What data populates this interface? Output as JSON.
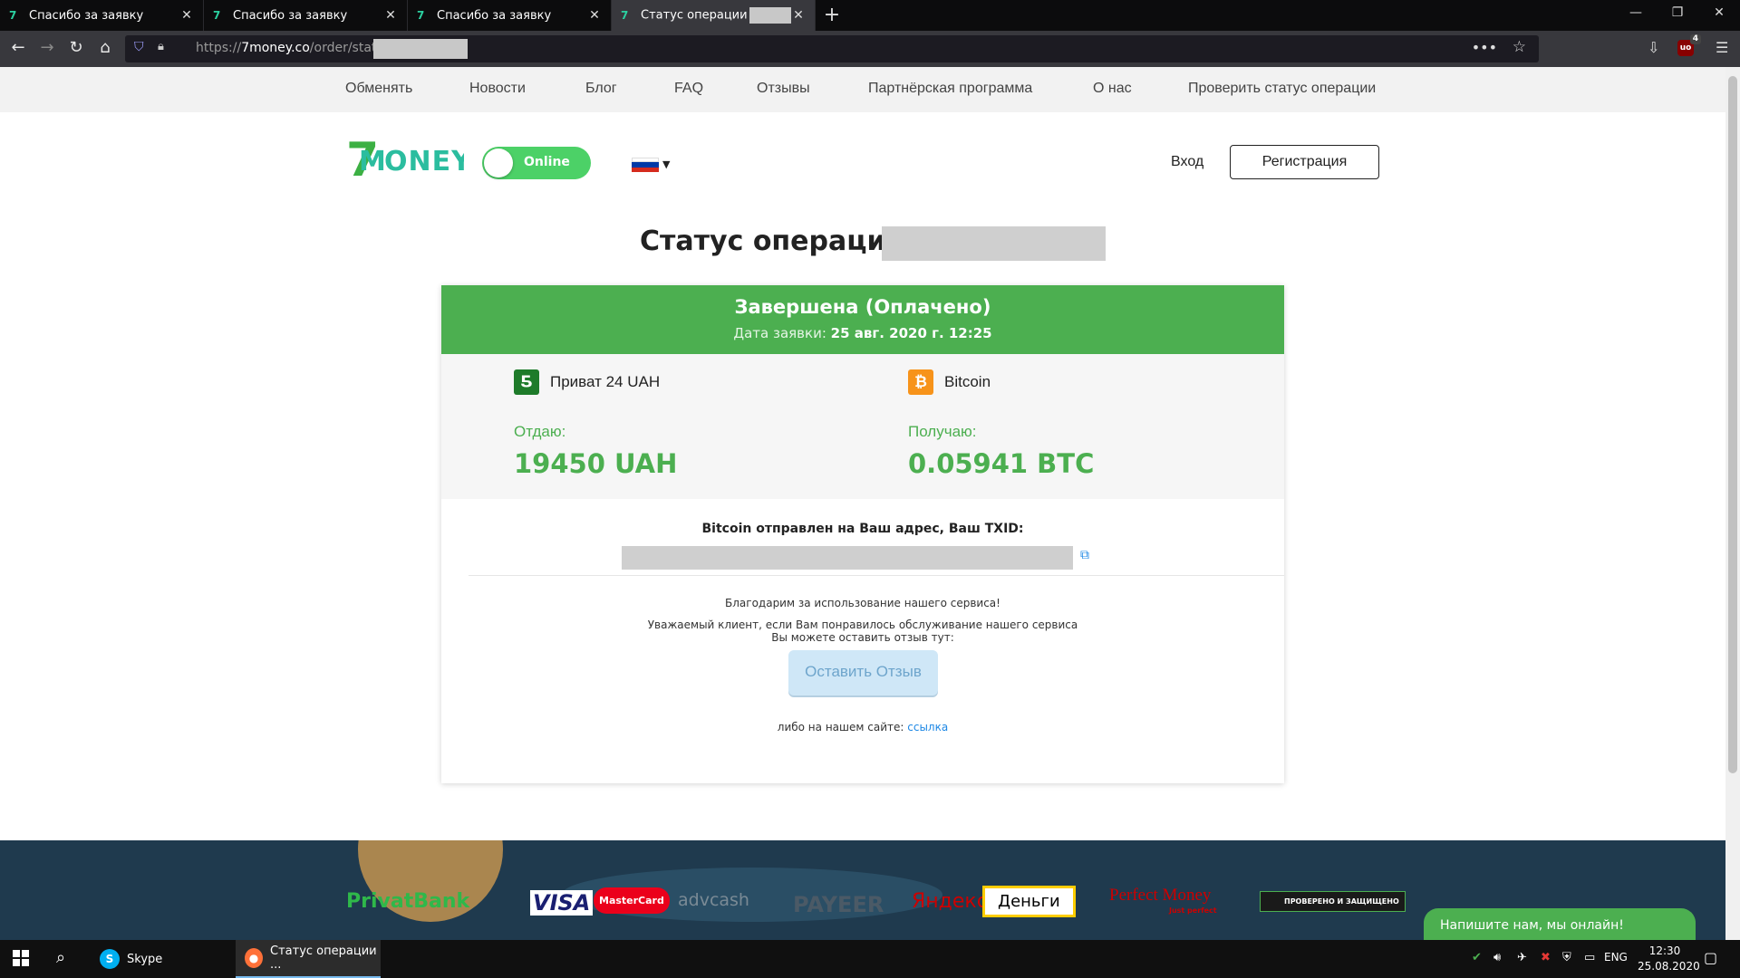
{
  "browser": {
    "tabs": [
      {
        "label": "Спасибо за заявку"
      },
      {
        "label": "Спасибо за заявку"
      },
      {
        "label": "Спасибо за заявку"
      },
      {
        "label": "Статус операции"
      }
    ],
    "url_prefix": "https://",
    "url_host": "7money.co",
    "url_path": "/order/status"
  },
  "site": {
    "menu": [
      "Обменять",
      "Новости",
      "Блог",
      "FAQ",
      "Отзывы",
      "Партнёрская программа",
      "О нас",
      "Проверить статус операции"
    ],
    "logo_text": "7MONEY",
    "online_label": "Online",
    "login_label": "Вход",
    "register_label": "Регистрация"
  },
  "operation": {
    "title": "Статус операции",
    "status": "Завершена (Оплачено)",
    "date_label": "Дата заявки:",
    "date_value": "25 авг. 2020 г. 12:25",
    "give": {
      "currency": "Приват 24 UAH",
      "label": "Отдаю:",
      "amount": "19450 UAH"
    },
    "receive": {
      "currency": "Bitcoin",
      "label": "Получаю:",
      "amount": "0.05941 BTC"
    },
    "txid_label": "Bitcoin отправлен на Ваш адрес, Ваш TXID:",
    "thanks": "Благодарим за использование нашего сервиса!",
    "dear_client": "Уважаемый клиент, если Вам понравилось обслуживание нашего сервиса",
    "review_hint": "Вы можете оставить отзыв тут:",
    "review_button": "Оставить Отзыв",
    "site_prefix": "либо на нашем сайте:",
    "site_link": "ссылка"
  },
  "footer": {
    "partners": [
      "PrivatBank",
      "VISA",
      "MasterCard",
      "advcash",
      "PAYEER",
      "Яндекс",
      "Деньги",
      "Perfect Money",
      "Just perfect",
      "ПРОВЕРЕНО И ЗАЩИЩЕНО"
    ]
  },
  "chat": {
    "label": "Напишите нам, мы онлайн!"
  },
  "taskbar": {
    "apps": [
      "Skype",
      "Статус операции ..."
    ],
    "lang": "ENG",
    "time": "12:30",
    "date": "25.08.2020"
  },
  "colors": {
    "accent_green": "#4caf50",
    "link_blue": "#1e88e5",
    "footer_bg": "#1f3a4e"
  }
}
